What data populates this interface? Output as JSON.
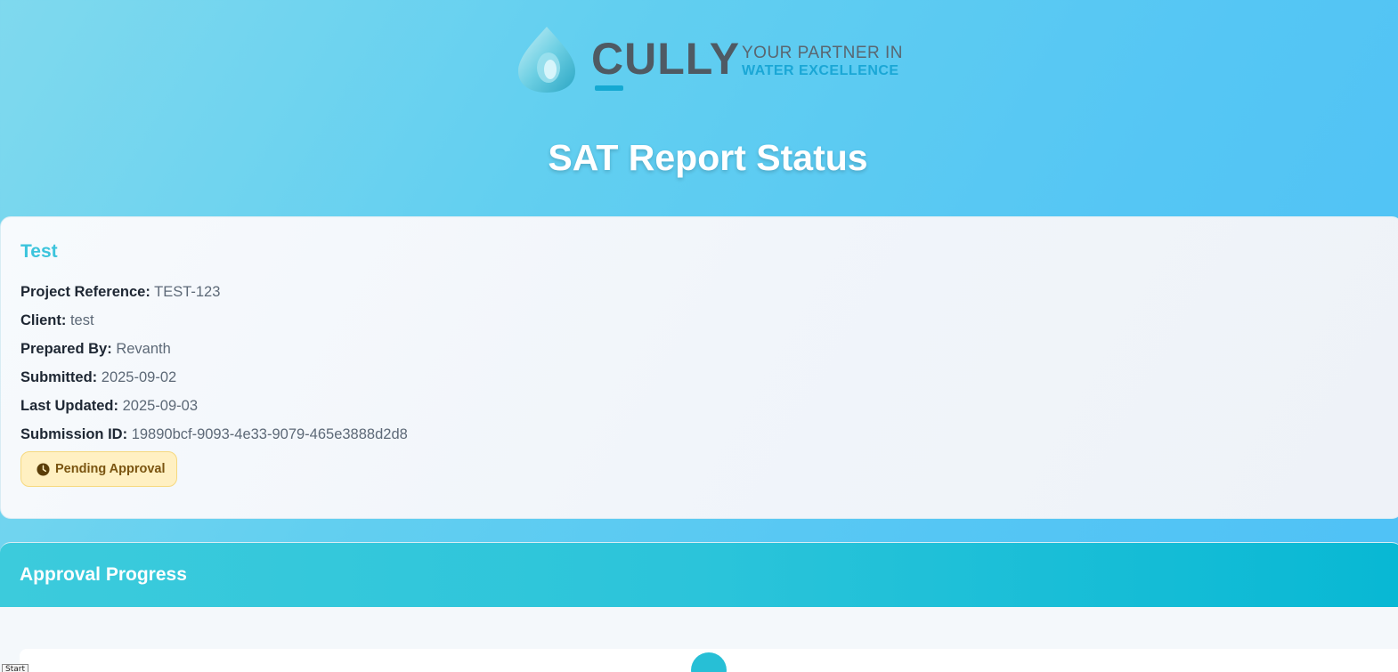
{
  "logo": {
    "wordmark": "CULLY",
    "tagline_line1": "YOUR PARTNER IN",
    "tagline_line2": "WATER EXCELLENCE",
    "icon": "water-drop-icon"
  },
  "page_title": "SAT Report Status",
  "report": {
    "title": "Test",
    "fields": [
      {
        "label": "Project Reference:",
        "value": "TEST-123"
      },
      {
        "label": "Client:",
        "value": "test"
      },
      {
        "label": "Prepared By:",
        "value": "Revanth"
      },
      {
        "label": "Submitted:",
        "value": "2025-09-02"
      },
      {
        "label": "Last Updated:",
        "value": "2025-09-03"
      },
      {
        "label": "Submission ID:",
        "value": "19890bcf-9093-4e33-9079-465e3888d2d8"
      }
    ],
    "status": {
      "label": "Pending Approval",
      "icon": "clock-icon",
      "color": "#7a5410",
      "background": "#fff0c2"
    }
  },
  "approval_progress": {
    "title": "Approval Progress"
  },
  "taskbar": {
    "start_label": "Start"
  },
  "colors": {
    "accent": "#3cc4dc",
    "header_gradient_end": "#08b8d4",
    "label_text": "#1e2733",
    "value_text": "#5d6977"
  }
}
